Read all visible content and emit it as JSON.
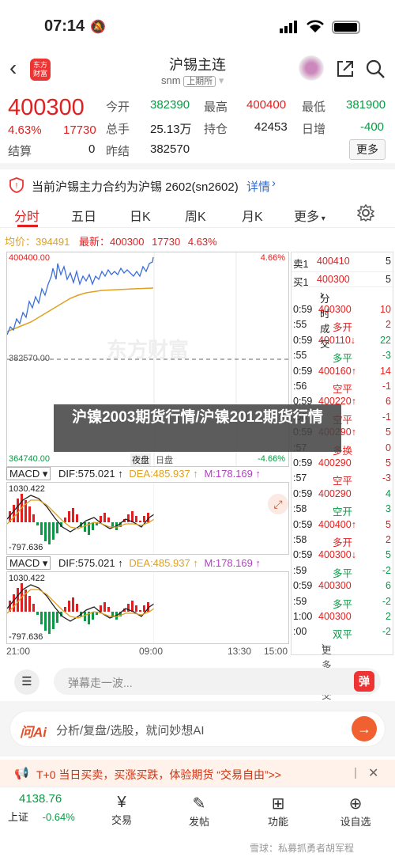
{
  "status": {
    "time": "07:14"
  },
  "header": {
    "title": "沪锡主连",
    "code": "snm",
    "market": "上期所",
    "logo_text": "东方\n财富"
  },
  "quote": {
    "price": "400300",
    "change_pct": "4.63%",
    "change_val": "17730",
    "open_label": "今开",
    "open": "382390",
    "high_label": "最高",
    "high": "400400",
    "low_label": "最低",
    "low": "381900",
    "vol_label": "总手",
    "vol": "25.13万",
    "oi_label": "持仓",
    "oi": "42453",
    "oi_chg_label": "日增",
    "oi_chg": "-400",
    "settle_label": "结算",
    "settle": "0",
    "prev_label": "昨结",
    "prev": "382570",
    "more": "更多"
  },
  "notice": {
    "text": "当前沪锡主力合约为沪锡 2602(sn2602)",
    "link": "详情"
  },
  "tabs": [
    "分时",
    "五日",
    "日K",
    "周K",
    "月K",
    "更多"
  ],
  "legend": {
    "avg_label": "均价：",
    "avg": "394491",
    "latest_label": "最新：",
    "latest": "400300",
    "chg": "17730",
    "pct": "4.63%"
  },
  "chart": {
    "top_label": "400400.00",
    "top_pct": "4.66%",
    "mid_label": "382570.00",
    "bot_label": "364740.00",
    "bot_pct": "-4.66%",
    "night": "夜盘",
    "day": "日盘",
    "watermark": "东方财富"
  },
  "orderbook": {
    "sell_label": "卖1",
    "sell_price": "400410",
    "sell_vol": "5",
    "buy_label": "买1",
    "buy_price": "400300",
    "buy_vol": "5",
    "trades_title": "分时成交",
    "more": "更多成交",
    "rows": [
      {
        "t": "0:59",
        "p": "400300",
        "v": "10",
        "c": "red"
      },
      {
        "t": ":55",
        "p": "多开",
        "v": "2",
        "c": "red"
      },
      {
        "t": "0:59",
        "p": "400110↓",
        "v": "22",
        "c": "grn"
      },
      {
        "t": ":55",
        "p": "多平",
        "v": "-3",
        "c": "grn"
      },
      {
        "t": "0:59",
        "p": "400160↑",
        "v": "14",
        "c": "red"
      },
      {
        "t": ":56",
        "p": "空平",
        "v": "-1",
        "c": "red"
      },
      {
        "t": "0:59",
        "p": "400220↑",
        "v": "6",
        "c": "red"
      },
      {
        "t": ":56",
        "p": "空平",
        "v": "-1",
        "c": "red"
      },
      {
        "t": "0:59",
        "p": "400290↑",
        "v": "5",
        "c": "red"
      },
      {
        "t": ":57",
        "p": "多换",
        "v": "0",
        "c": "red"
      },
      {
        "t": "0:59",
        "p": "400290",
        "v": "5",
        "c": "red"
      },
      {
        "t": ":57",
        "p": "空平",
        "v": "-3",
        "c": "red"
      },
      {
        "t": "0:59",
        "p": "400290",
        "v": "4",
        "c": "grn"
      },
      {
        "t": ":58",
        "p": "空开",
        "v": "3",
        "c": "grn"
      },
      {
        "t": "0:59",
        "p": "400400↑",
        "v": "5",
        "c": "red"
      },
      {
        "t": ":58",
        "p": "多开",
        "v": "2",
        "c": "red"
      },
      {
        "t": "0:59",
        "p": "400300↓",
        "v": "5",
        "c": "grn"
      },
      {
        "t": ":59",
        "p": "多平",
        "v": "-2",
        "c": "grn"
      },
      {
        "t": "0:59",
        "p": "400300",
        "v": "6",
        "c": "grn"
      },
      {
        "t": ":59",
        "p": "多平",
        "v": "-2",
        "c": "grn"
      },
      {
        "t": "1:00",
        "p": "400300",
        "v": "2",
        "c": "grn"
      },
      {
        "t": ":00",
        "p": "双平",
        "v": "-2",
        "c": "grn"
      }
    ]
  },
  "macd1": {
    "name": "MACD",
    "dif": "DIF:575.021",
    "dea": "DEA:485.937",
    "m": "M:178.169",
    "top": "1030.422",
    "bot": "-797.636"
  },
  "macd2": {
    "name": "MACD",
    "dif": "DIF:575.021",
    "dea": "DEA:485.937",
    "m": "M:178.169",
    "top": "1030.422",
    "bot": "-797.636"
  },
  "time_axis": [
    "21:00",
    "09:00",
    "13:30",
    "15:00"
  ],
  "comment": {
    "placeholder": "弹幕走一波...",
    "btn": "弹"
  },
  "ai": {
    "brand": "问Ai",
    "placeholder": "分析/复盘/选股，就问妙想AI"
  },
  "promo": {
    "text": "T+0 当日买卖，买涨买跌，体验期货 “交易自由”>>"
  },
  "bottom": {
    "index_value": "4138.76",
    "index_name": "上证",
    "index_pct": "-0.64%",
    "items": [
      "交易",
      "发帖",
      "功能",
      "设自选"
    ]
  },
  "overlay": {
    "text": "沪镍2003期货行情/沪镍2012期货行情"
  },
  "watermark": {
    "text": "雪球：私募抓勇者胡军程"
  }
}
